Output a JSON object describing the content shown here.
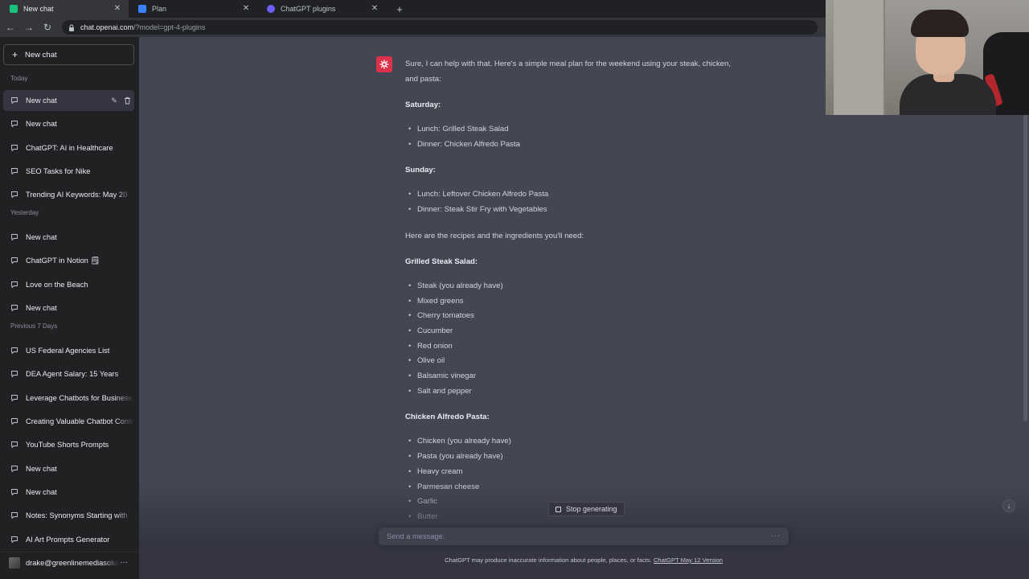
{
  "browser": {
    "tabs": [
      {
        "label": "New chat",
        "active": true,
        "favicon_color": "#19c37d"
      },
      {
        "label": "Plan",
        "active": false,
        "favicon_color": "#3b82f6"
      },
      {
        "label": "ChatGPT plugins",
        "active": false,
        "favicon_color": "#6d5dfc"
      }
    ],
    "url_host": "chat.openai.com",
    "url_path": "/?model=gpt-4-plugins"
  },
  "sidebar": {
    "new_chat_label": "New chat",
    "groups": [
      {
        "label": "Today",
        "items": [
          "New chat",
          "New chat",
          "ChatGPT: AI in Healthcare",
          "SEO Tasks for Nike",
          "Trending AI Keywords: May 20"
        ]
      },
      {
        "label": "Yesterday",
        "items": [
          "New chat",
          "ChatGPT in Notion 🗒",
          "Love on the Beach",
          "New chat"
        ]
      },
      {
        "label": "Previous 7 Days",
        "items": [
          "US Federal Agencies List",
          "DEA Agent Salary: 15 Years",
          "Leverage Chatbots for Business",
          "Creating Valuable Chatbot Content",
          "YouTube Shorts Prompts",
          "New chat",
          "New chat",
          "Notes: Synonyms Starting with",
          "AI Art Prompts Generator"
        ]
      }
    ],
    "user_email": "drake@greenlinemediasolutions.com"
  },
  "conversation": {
    "intro": "Sure, I can help with that. Here's a simple meal plan for the weekend using your steak, chicken, and pasta:",
    "saturday_title": "Saturday:",
    "saturday_items": [
      "Lunch: Grilled Steak Salad",
      "Dinner: Chicken Alfredo Pasta"
    ],
    "sunday_title": "Sunday:",
    "sunday_items": [
      "Lunch: Leftover Chicken Alfredo Pasta",
      "Dinner: Steak Stir Fry with Vegetables"
    ],
    "recipes_intro": "Here are the recipes and the ingredients you'll need:",
    "salad_title": "Grilled Steak Salad:",
    "salad_items": [
      "Steak (you already have)",
      "Mixed greens",
      "Cherry tomatoes",
      "Cucumber",
      "Red onion",
      "Olive oil",
      "Balsamic vinegar",
      "Salt and pepper"
    ],
    "alfredo_title": "Chicken Alfredo Pasta:",
    "alfredo_items": [
      "Chicken (you already have)",
      "Pasta (you already have)",
      "Heavy cream",
      "Parmesan cheese",
      "Garlic",
      "Butter"
    ]
  },
  "composer": {
    "stop_label": "Stop generating",
    "placeholder": "Send a message.",
    "disclaimer": "ChatGPT may produce inaccurate information about people, places, or facts.",
    "version_link": "ChatGPT May 12 Version"
  },
  "colors": {
    "sidebar_bg": "#202123",
    "main_bg": "#444654",
    "bot_avatar": "#d9324a"
  }
}
